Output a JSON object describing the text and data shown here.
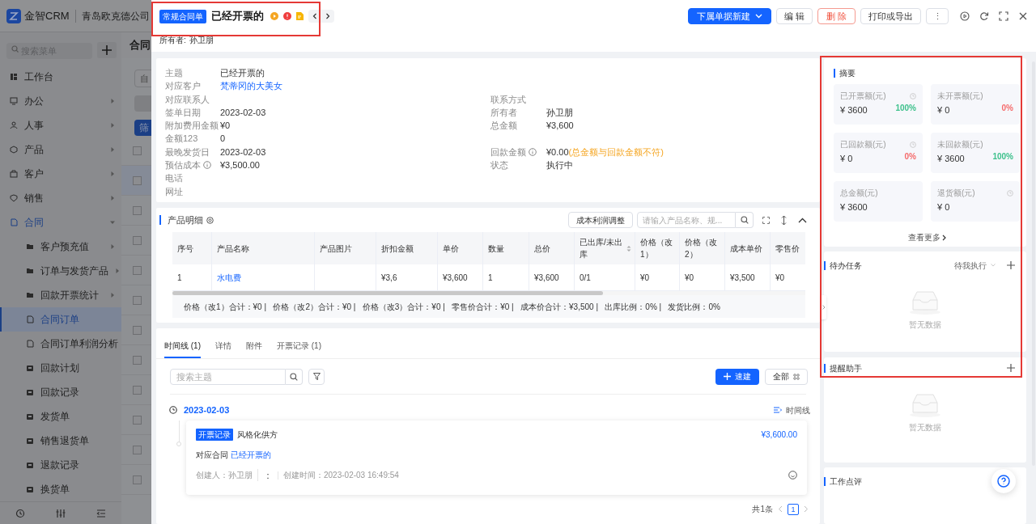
{
  "app": {
    "logo": "金智CRM",
    "company": "青岛欧克德公司"
  },
  "sidebar": {
    "search_placeholder": "搜索菜单",
    "items": [
      {
        "label": "工作台",
        "submenu": false,
        "selected": false
      },
      {
        "label": "办公",
        "submenu": true,
        "expanded": false,
        "selected": false
      },
      {
        "label": "人事",
        "submenu": true,
        "expanded": false,
        "selected": false
      },
      {
        "label": "产品",
        "submenu": true,
        "expanded": false,
        "selected": false
      },
      {
        "label": "客户",
        "submenu": true,
        "expanded": false,
        "selected": false
      },
      {
        "label": "销售",
        "submenu": true,
        "expanded": false,
        "selected": false
      },
      {
        "label": "合同",
        "submenu": true,
        "expanded": true,
        "selected": false,
        "children": [
          {
            "label": "客户预充值",
            "submenu": true,
            "expanded": false,
            "selected": false
          },
          {
            "label": "订单与发货产品",
            "submenu": true,
            "expanded": false,
            "selected": false
          },
          {
            "label": "回款开票统计",
            "submenu": true,
            "expanded": false,
            "selected": false
          },
          {
            "label": "合同订单",
            "submenu": false,
            "selected": true
          },
          {
            "label": "合同订单利润分析",
            "submenu": false,
            "selected": false
          },
          {
            "label": "回款计划",
            "submenu": false,
            "selected": false
          },
          {
            "label": "回款记录",
            "submenu": false,
            "selected": false
          },
          {
            "label": "发货单",
            "submenu": false,
            "selected": false
          },
          {
            "label": "销售退货单",
            "submenu": false,
            "selected": false
          },
          {
            "label": "退款记录",
            "submenu": false,
            "selected": false
          },
          {
            "label": "换货单",
            "submenu": false,
            "selected": false
          }
        ]
      }
    ]
  },
  "background_page": {
    "title": "合同",
    "filter_text": "自",
    "filter_button": "筛",
    "rows": [
      {
        "checked": false
      },
      {
        "checked": false
      },
      {
        "checked": false
      },
      {
        "checked": false
      },
      {
        "checked": false
      },
      {
        "checked": false
      },
      {
        "checked": false
      },
      {
        "checked": false
      },
      {
        "checked": false
      },
      {
        "checked": false
      },
      {
        "checked": false
      },
      {
        "checked": false
      }
    ]
  },
  "record": {
    "type_tag": "常规合同单",
    "title": "已经开票的",
    "owner_label": "所有者:",
    "owner": "孙卫朋",
    "actions": [
      {
        "label": "下属单据新建",
        "kind": "primary"
      },
      {
        "label": "编 辑",
        "kind": "default"
      },
      {
        "label": "删 除",
        "kind": "danger"
      },
      {
        "label": "打印或导出",
        "kind": "default"
      },
      {
        "label": "⋮",
        "kind": "more"
      }
    ]
  },
  "info_rows": [
    {
      "left": {
        "label": "主题",
        "value": "已经开票的"
      }
    },
    {
      "left": {
        "label": "对应客户",
        "value": "梵蒂冈的大美女",
        "kind": "link"
      }
    },
    {
      "left": {
        "label": "对应联系人"
      },
      "right": {
        "label": "联系方式"
      }
    },
    {
      "left": {
        "label": "签单日期",
        "value": "2023-02-03"
      },
      "right": {
        "label": "所有者",
        "value": "孙卫朋"
      }
    },
    {
      "left": {
        "label": "附加费用金额",
        "value": "¥0"
      },
      "right": {
        "label": "总金额",
        "value": "¥3,600"
      }
    },
    {
      "left": {
        "label": "金额123",
        "value": "0"
      }
    },
    {
      "left": {
        "label": "最晚发货日",
        "value": "2023-02-03"
      },
      "right": {
        "label": "回款金额",
        "info": true,
        "value": "¥0.00",
        "note": "(总金额与回款金额不符)"
      }
    },
    {
      "left": {
        "label": "预估成本",
        "info": true,
        "value": "¥3,500.00"
      },
      "right": {
        "label": "状态",
        "value": "执行中"
      }
    },
    {
      "left": {
        "label": "电话"
      }
    },
    {
      "left": {
        "label": "网址"
      }
    }
  ],
  "products": {
    "title": "产品明细",
    "adjust_button": "成本利润调整",
    "search_placeholder": "请输入产品名称、规...",
    "columns": [
      {
        "label": "序号",
        "kind": "text",
        "sortable": false
      },
      {
        "label": "产品名称",
        "kind": "link",
        "sortable": false
      },
      {
        "label": "产品图片",
        "kind": "text",
        "sortable": false
      },
      {
        "label": "折扣金额",
        "kind": "text",
        "sortable": false
      },
      {
        "label": "单价",
        "kind": "text",
        "sortable": false
      },
      {
        "label": "数量",
        "kind": "text",
        "sortable": false
      },
      {
        "label": "总价",
        "kind": "text",
        "sortable": false
      },
      {
        "label": "已出库/未出库",
        "kind": "text",
        "sortable": true
      },
      {
        "label": "价格（改1）",
        "kind": "text",
        "sortable": false
      },
      {
        "label": "价格（改2）",
        "kind": "text",
        "sortable": false
      },
      {
        "label": "成本单价",
        "kind": "text",
        "sortable": false
      },
      {
        "label": "零售价",
        "kind": "text",
        "sortable": false
      }
    ],
    "rows": [
      [
        "1",
        "水电费",
        "",
        "¥3,6",
        "¥3,600",
        "1",
        "¥3,600",
        "0/1",
        "¥0",
        "¥0",
        "¥3,500",
        "¥0"
      ]
    ],
    "summary": "价格（改1）合计：¥0 |   价格（改2）合计：¥0 |   价格（改3）合计：¥0 |   零售价合计：¥0 |   成本价合计：¥3,500 |   出库比例：0% |   发货比例：0%"
  },
  "timeline": {
    "tabs": [
      {
        "label": "时间线 (1)",
        "selected": true
      },
      {
        "label": "详情",
        "selected": false
      },
      {
        "label": "附件",
        "selected": false
      },
      {
        "label": "开票记录 (1)",
        "selected": false
      }
    ],
    "search_placeholder": "搜索主题",
    "create_button": "速建",
    "all_button": "全部",
    "view_label": "时间线",
    "groups": [
      {
        "date": "2023-02-03",
        "entries": [
          {
            "tag": "开票记录",
            "title": "风格化供方",
            "amount": "¥3,600.00",
            "contract_label": "对应合同",
            "contract": "已经开票的",
            "creator": "创建人：孙卫朋",
            "separator": "：",
            "created": "创建时间：2023-02-03 16:49:54"
          }
        ]
      }
    ],
    "pagination": {
      "total": "共1条",
      "pages": [
        {
          "label": "1",
          "selected": true
        }
      ]
    }
  },
  "summary": {
    "title": "摘要",
    "stats": [
      {
        "label": "已开票额(元)",
        "value": "¥ 3600",
        "percent": "100%",
        "color": "#3ec18c",
        "clock": true
      },
      {
        "label": "未开票额(元)",
        "value": "¥ 0",
        "percent": "0%",
        "color": "#f56c6c",
        "clock": false
      },
      {
        "label": "已回款额(元)",
        "value": "¥ 0",
        "percent": "0%",
        "color": "#f56c6c",
        "clock": true
      },
      {
        "label": "未回款额(元)",
        "value": "¥ 3600",
        "percent": "100%",
        "color": "#3ec18c",
        "clock": false
      },
      {
        "label": "总金额(元)",
        "value": "¥ 3600",
        "clock": false
      },
      {
        "label": "退货额(元)",
        "value": "¥ 0",
        "clock": true
      }
    ],
    "more": "查看更多"
  },
  "tasks": {
    "title": "待办任务",
    "filter": "待我执行",
    "empty": "暂无数据"
  },
  "reminders": {
    "title": "提醒助手",
    "empty": "暂无数据"
  },
  "review": {
    "title": "工作点评"
  }
}
